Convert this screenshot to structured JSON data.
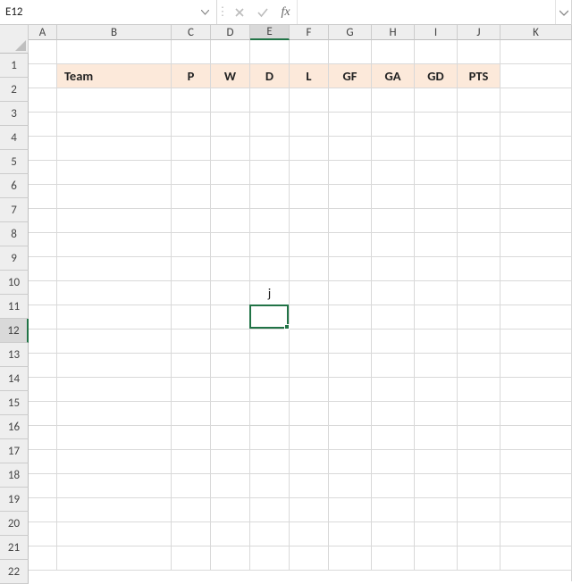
{
  "name_box": {
    "value": "E12"
  },
  "formula_bar": {
    "fx_label": "fx",
    "value": ""
  },
  "columns": [
    {
      "letter": "A",
      "cls": "cA",
      "active": false
    },
    {
      "letter": "B",
      "cls": "cB",
      "active": false
    },
    {
      "letter": "C",
      "cls": "cC",
      "active": false
    },
    {
      "letter": "D",
      "cls": "cD",
      "active": false
    },
    {
      "letter": "E",
      "cls": "cE",
      "active": true
    },
    {
      "letter": "F",
      "cls": "cF",
      "active": false
    },
    {
      "letter": "G",
      "cls": "cG",
      "active": false
    },
    {
      "letter": "H",
      "cls": "cH",
      "active": false
    },
    {
      "letter": "I",
      "cls": "cI",
      "active": false
    },
    {
      "letter": "J",
      "cls": "cJ",
      "active": false
    },
    {
      "letter": "K",
      "cls": "cK",
      "active": false
    }
  ],
  "row_count": 22,
  "active_row": 12,
  "selection": {
    "cell": "E12",
    "col_index": 4,
    "row_index": 11
  },
  "headers": {
    "row": 2,
    "cells": {
      "B": "Team",
      "C": "P",
      "D": "W",
      "E": "D",
      "F": "L",
      "G": "GF",
      "H": "GA",
      "I": "GD",
      "J": "PTS"
    }
  },
  "data_cells": [
    {
      "row": 11,
      "col": "E",
      "value": "j"
    }
  ],
  "colors": {
    "header_fill": "#fce9da",
    "selection": "#217346",
    "gridline": "#d9d9d9",
    "header_bg": "#eee"
  }
}
